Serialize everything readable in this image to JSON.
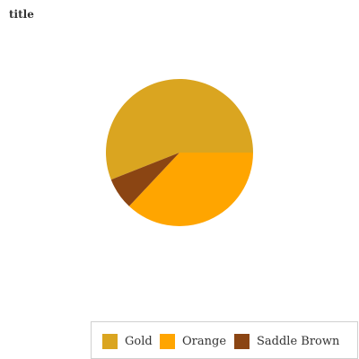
{
  "chart_data": {
    "type": "pie",
    "title": "title",
    "categories": [
      "Gold",
      "Orange",
      "Saddle Brown"
    ],
    "values": [
      56,
      37,
      7
    ],
    "colors": [
      "#DAA520",
      "#FFA500",
      "#8B4513"
    ],
    "legend_position": "bottom-right"
  }
}
